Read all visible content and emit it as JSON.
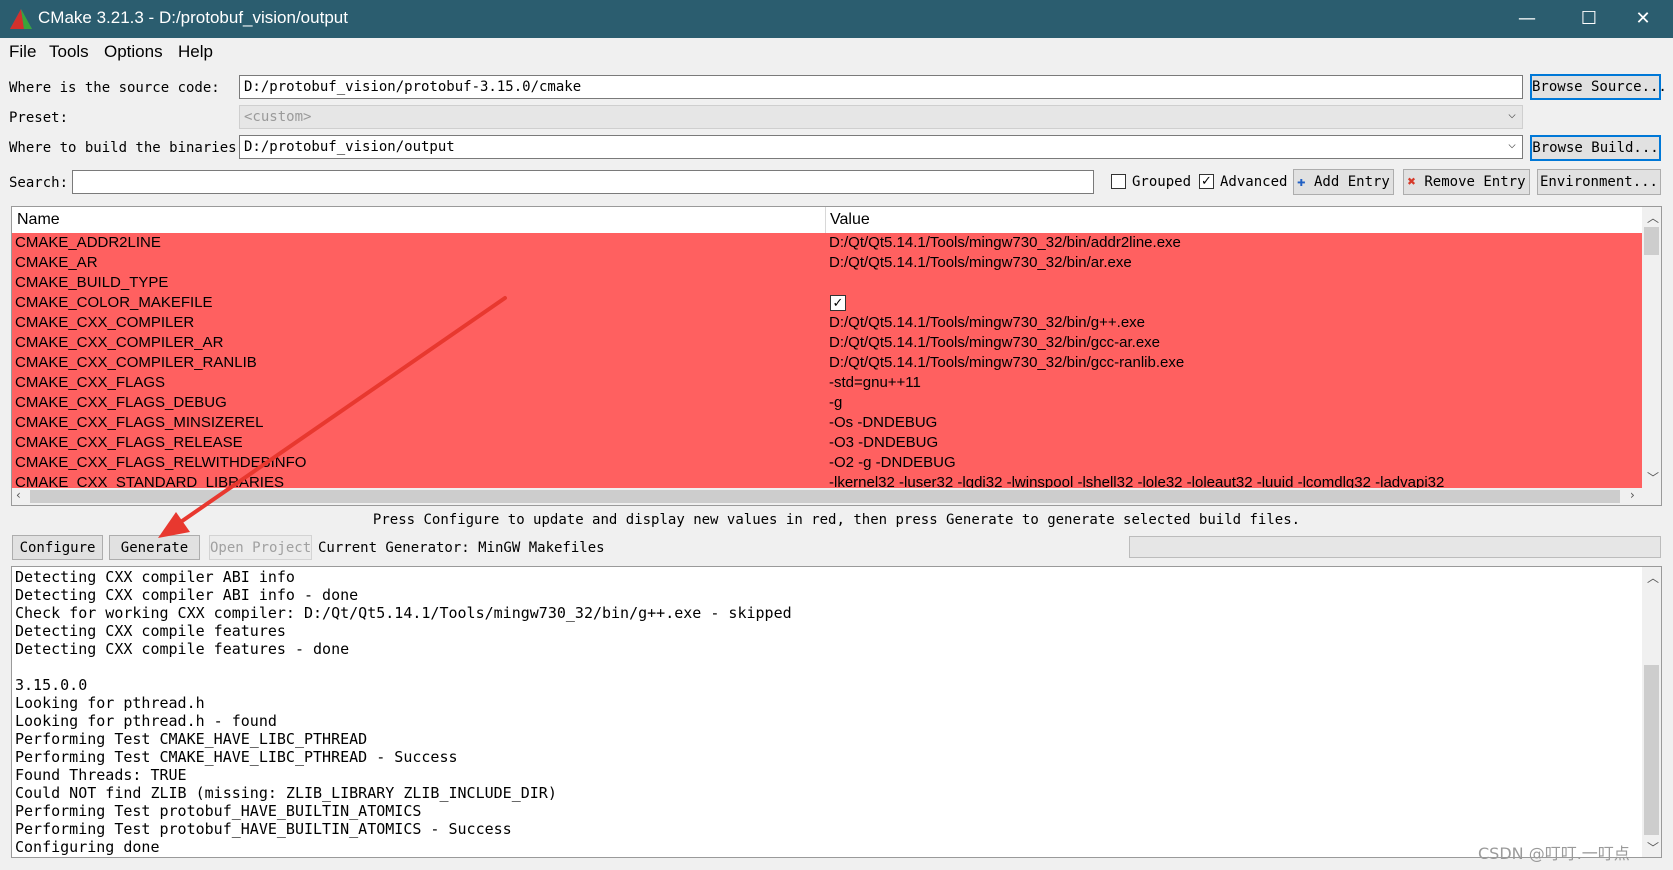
{
  "window": {
    "title": "CMake 3.21.3 - D:/protobuf_vision/output",
    "min_glyph": "—",
    "max_glyph": "☐",
    "close_glyph": "✕"
  },
  "menu": [
    "File",
    "Tools",
    "Options",
    "Help"
  ],
  "source": {
    "label": "Where is the source code:",
    "value": "D:/protobuf_vision/protobuf-3.15.0/cmake",
    "button": "Browse Source..."
  },
  "preset": {
    "label": "Preset:",
    "value": "<custom>"
  },
  "build": {
    "label": "Where to build the binaries:",
    "value": "D:/protobuf_vision/output",
    "button": "Browse Build..."
  },
  "search": {
    "label": "Search:",
    "value": ""
  },
  "options": {
    "grouped_label": "Grouped",
    "grouped_checked": false,
    "advanced_label": "Advanced",
    "advanced_checked": true
  },
  "buttons": {
    "add_entry": "Add Entry",
    "remove_entry": "Remove Entry",
    "environment": "Environment...",
    "configure": "Configure",
    "generate": "Generate",
    "open_project": "Open Project"
  },
  "table": {
    "headers": {
      "name": "Name",
      "value": "Value"
    },
    "rows": [
      {
        "name": "CMAKE_ADDR2LINE",
        "value": "D:/Qt/Qt5.14.1/Tools/mingw730_32/bin/addr2line.exe"
      },
      {
        "name": "CMAKE_AR",
        "value": "D:/Qt/Qt5.14.1/Tools/mingw730_32/bin/ar.exe"
      },
      {
        "name": "CMAKE_BUILD_TYPE",
        "value": ""
      },
      {
        "name": "CMAKE_COLOR_MAKEFILE",
        "value": "",
        "checkbox": true
      },
      {
        "name": "CMAKE_CXX_COMPILER",
        "value": "D:/Qt/Qt5.14.1/Tools/mingw730_32/bin/g++.exe"
      },
      {
        "name": "CMAKE_CXX_COMPILER_AR",
        "value": "D:/Qt/Qt5.14.1/Tools/mingw730_32/bin/gcc-ar.exe"
      },
      {
        "name": "CMAKE_CXX_COMPILER_RANLIB",
        "value": "D:/Qt/Qt5.14.1/Tools/mingw730_32/bin/gcc-ranlib.exe"
      },
      {
        "name": "CMAKE_CXX_FLAGS",
        "value": "-std=gnu++11"
      },
      {
        "name": "CMAKE_CXX_FLAGS_DEBUG",
        "value": "-g"
      },
      {
        "name": "CMAKE_CXX_FLAGS_MINSIZEREL",
        "value": "-Os -DNDEBUG"
      },
      {
        "name": "CMAKE_CXX_FLAGS_RELEASE",
        "value": "-O3 -DNDEBUG"
      },
      {
        "name": "CMAKE_CXX_FLAGS_RELWITHDEBINFO",
        "value": "-O2 -g -DNDEBUG"
      },
      {
        "name": "CMAKE_CXX_STANDARD_LIBRARIES",
        "value": "-lkernel32 -luser32 -lgdi32 -lwinspool -lshell32 -lole32 -loleaut32 -luuid -lcomdlg32 -ladvapi32"
      }
    ],
    "row_color": "#ff6060"
  },
  "hint": "Press Configure to update and display new values in red, then press Generate to generate selected build files.",
  "generator": "Current Generator: MinGW Makefiles",
  "log": [
    "Detecting CXX compiler ABI info",
    "Detecting CXX compiler ABI info - done",
    "Check for working CXX compiler: D:/Qt/Qt5.14.1/Tools/mingw730_32/bin/g++.exe - skipped",
    "Detecting CXX compile features",
    "Detecting CXX compile features - done",
    "",
    "3.15.0.0",
    "Looking for pthread.h",
    "Looking for pthread.h - found",
    "Performing Test CMAKE_HAVE_LIBC_PTHREAD",
    "Performing Test CMAKE_HAVE_LIBC_PTHREAD - Success",
    "Found Threads: TRUE",
    "Could NOT find ZLIB (missing: ZLIB_LIBRARY ZLIB_INCLUDE_DIR)",
    "Performing Test protobuf_HAVE_BUILTIN_ATOMICS",
    "Performing Test protobuf_HAVE_BUILTIN_ATOMICS - Success",
    "Configuring done"
  ],
  "watermark": "CSDN @叮叮.一叮点",
  "colors": {
    "titlebar": "#2b5d6f",
    "arrow": "#e8382f"
  }
}
